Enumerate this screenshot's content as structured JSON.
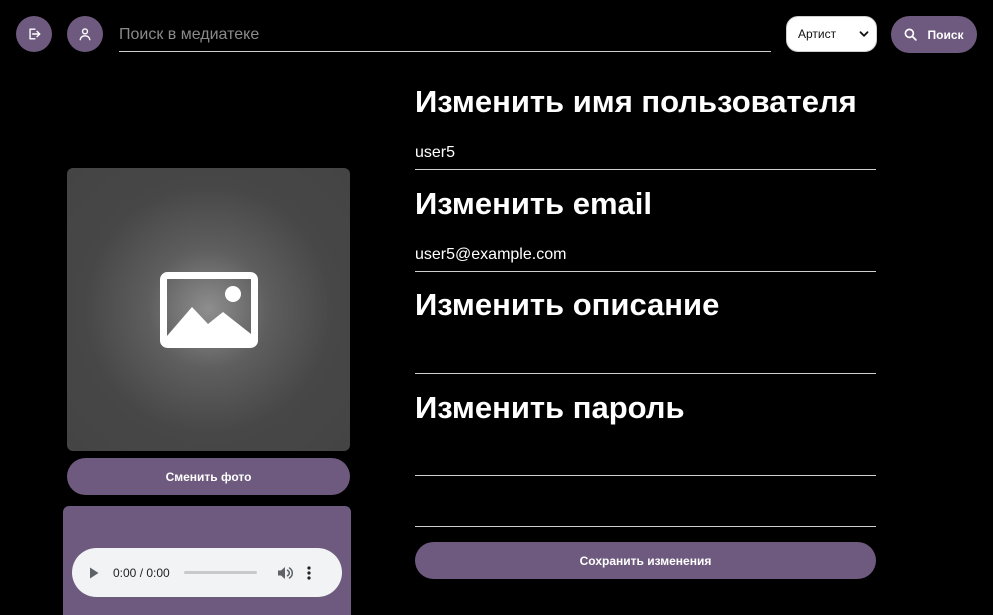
{
  "colors": {
    "accent": "#6e5a7e",
    "background": "#000000",
    "text": "#ffffff",
    "field_border": "#cfcfcf",
    "placeholder_bg": "#474747"
  },
  "header": {
    "logout_icon": "logout-icon",
    "profile_icon": "user-icon",
    "search": {
      "placeholder": "Поиск в медиатеке",
      "value": ""
    },
    "type_select": {
      "selected": "Артист"
    },
    "search_button": {
      "icon": "search-icon",
      "label": "Поиск"
    }
  },
  "profile": {
    "photo_icon": "image-placeholder-icon",
    "change_photo_label": "Сменить фото",
    "audio": {
      "time": "0:00 / 0:00",
      "progress": 0
    }
  },
  "form": {
    "username": {
      "heading": "Изменить имя пользователя",
      "value": "user5"
    },
    "email": {
      "heading": "Изменить email",
      "value": "user5@example.com"
    },
    "description": {
      "heading": "Изменить описание",
      "value": ""
    },
    "password": {
      "heading": "Изменить пароль",
      "value": "",
      "confirm_value": ""
    },
    "save_label": "Сохранить изменения"
  }
}
